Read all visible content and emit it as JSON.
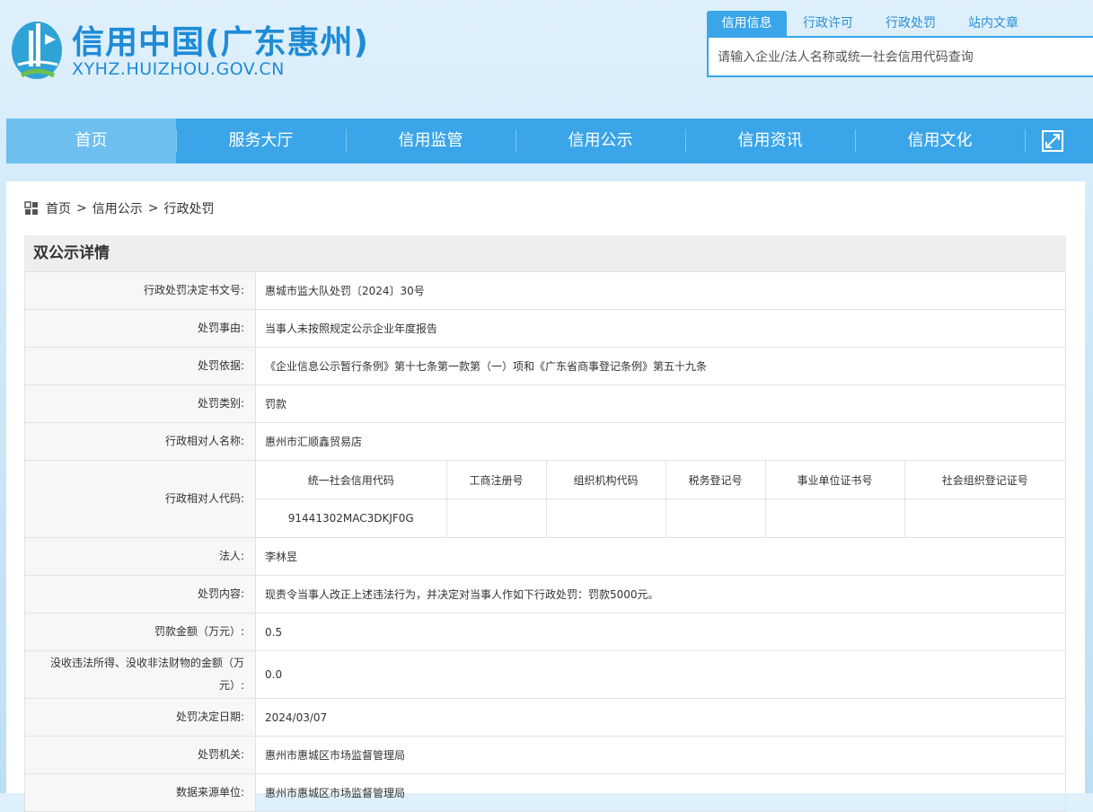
{
  "header": {
    "title": "信用中国(广东惠州)",
    "domain": "XYHZ.HUIZHOU.GOV.CN"
  },
  "search": {
    "tabs": [
      {
        "label": "信用信息",
        "active": true
      },
      {
        "label": "行政许可",
        "active": false
      },
      {
        "label": "行政处罚",
        "active": false
      },
      {
        "label": "站内文章",
        "active": false
      }
    ],
    "placeholder": "请输入企业/法人名称或统一社会信用代码查询"
  },
  "nav": {
    "items": [
      {
        "label": "首页",
        "active": true
      },
      {
        "label": "服务大厅",
        "active": false
      },
      {
        "label": "信用监管",
        "active": false
      },
      {
        "label": "信用公示",
        "active": false
      },
      {
        "label": "信用资讯",
        "active": false
      },
      {
        "label": "信用文化",
        "active": false
      }
    ],
    "expand_icon": "expand-icon"
  },
  "breadcrumb": {
    "items": [
      "首页",
      "信用公示",
      "行政处罚"
    ],
    "separator": ">"
  },
  "panel": {
    "title": "双公示详情",
    "rows": [
      {
        "label": "行政处罚决定书文号:",
        "value": "惠城市监大队处罚〔2024〕30号"
      },
      {
        "label": "处罚事由:",
        "value": "当事人未按照规定公示企业年度报告"
      },
      {
        "label": "处罚依据:",
        "value": "《企业信息公示暂行条例》第十七条第一款第（一）项和《广东省商事登记条例》第五十九条"
      },
      {
        "label": "处罚类别:",
        "value": "罚款"
      },
      {
        "label": "行政相对人名称:",
        "value": "惠州市汇顺鑫贸易店"
      }
    ],
    "codes": {
      "label": "行政相对人代码:",
      "headers": [
        "统一社会信用代码",
        "工商注册号",
        "组织机构代码",
        "税务登记号",
        "事业单位证书号",
        "社会组织登记证号"
      ],
      "values": [
        "91441302MAC3DKJF0G",
        "",
        "",
        "",
        "",
        ""
      ]
    },
    "rows2": [
      {
        "label": "法人:",
        "value": "李林昱"
      },
      {
        "label": "处罚内容:",
        "value": "现责令当事人改正上述违法行为，并决定对当事人作如下行政处罚：罚款5000元。"
      },
      {
        "label": "罚款金额（万元）:",
        "value": "0.5"
      },
      {
        "label": "没收违法所得、没收非法财物的金额（万元）:",
        "value": "0.0"
      },
      {
        "label": "处罚决定日期:",
        "value": "2024/03/07"
      },
      {
        "label": "处罚机关:",
        "value": "惠州市惠城区市场监督管理局"
      },
      {
        "label": "数据来源单位:",
        "value": "惠州市惠城区市场监督管理局"
      }
    ]
  },
  "colors": {
    "brand": "#1e8bd6",
    "nav_bg": "#3aa5e8",
    "nav_active": "#6cbfef"
  }
}
